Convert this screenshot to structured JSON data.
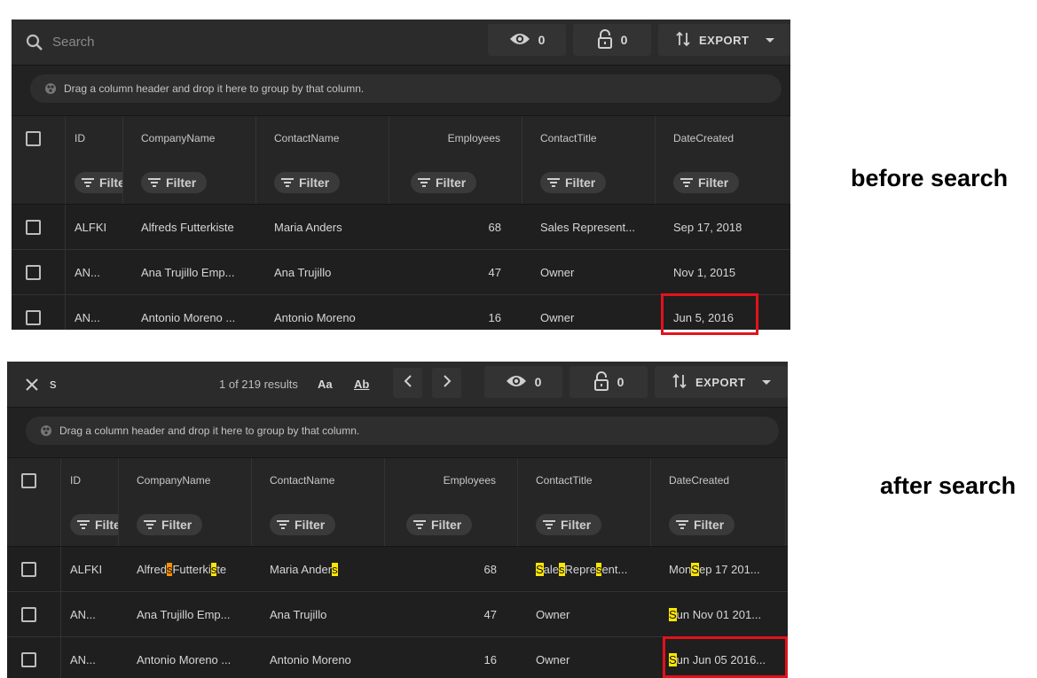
{
  "panels": {
    "before": {
      "search_placeholder": "Search",
      "visibility_count": "0",
      "lock_count": "0",
      "export_label": "EXPORT",
      "group_hint": "Drag a column header and drop it here to group by that column.",
      "columns": [
        "ID",
        "CompanyName",
        "ContactName",
        "Employees",
        "ContactTitle",
        "DateCreated"
      ],
      "filter_label": "Filter",
      "filter_label_truncated": "Filte",
      "rows": [
        {
          "id": "ALFKI",
          "company": "Alfreds Futterkiste",
          "contact": "Maria Anders",
          "employees": "68",
          "title": "Sales Represent...",
          "date": "Sep 17, 2018"
        },
        {
          "id": "AN...",
          "company": "Ana Trujillo Emp...",
          "contact": "Ana Trujillo",
          "employees": "47",
          "title": "Owner",
          "date": "Nov 1, 2015"
        },
        {
          "id": "AN...",
          "company": "Antonio Moreno ...",
          "contact": "Antonio Moreno",
          "employees": "16",
          "title": "Owner",
          "date": "Jun 5, 2016"
        }
      ]
    },
    "after": {
      "search_value": "s",
      "results_text": "1 of 219 results",
      "match_case_label": "Aa",
      "whole_word_label": "Ab",
      "visibility_count": "0",
      "lock_count": "0",
      "export_label": "EXPORT",
      "group_hint": "Drag a column header and drop it here to group by that column.",
      "columns": [
        "ID",
        "CompanyName",
        "ContactName",
        "Employees",
        "ContactTitle",
        "DateCreated"
      ],
      "filter_label": "Filter",
      "filter_label_truncated": "Filte",
      "rows": [
        {
          "id": "ALFKI",
          "company": [
            "Alfred",
            "s",
            " Futterki",
            "s",
            "te"
          ],
          "contact": [
            "Maria Ander",
            "s"
          ],
          "employees": "68",
          "title": [
            "",
            "S",
            "ale",
            "s",
            " Repre",
            "s",
            "ent..."
          ],
          "date": [
            "Mon ",
            "S",
            "ep 17 201..."
          ]
        },
        {
          "id": "AN...",
          "company": "Ana Trujillo Emp...",
          "contact": "Ana Trujillo",
          "employees": "47",
          "title": "Owner",
          "date": [
            "",
            "S",
            "un Nov 01 201..."
          ]
        },
        {
          "id": "AN...",
          "company": "Antonio Moreno ...",
          "contact": "Antonio Moreno",
          "employees": "16",
          "title": "Owner",
          "date": [
            "",
            "S",
            "un Jun 05 2016..."
          ]
        }
      ]
    }
  },
  "captions": {
    "before": "before search",
    "after": "after search"
  },
  "colors": {
    "highlight": "#ffe600",
    "current_match": "#ff8f00",
    "annotation_box": "#e3121b"
  }
}
